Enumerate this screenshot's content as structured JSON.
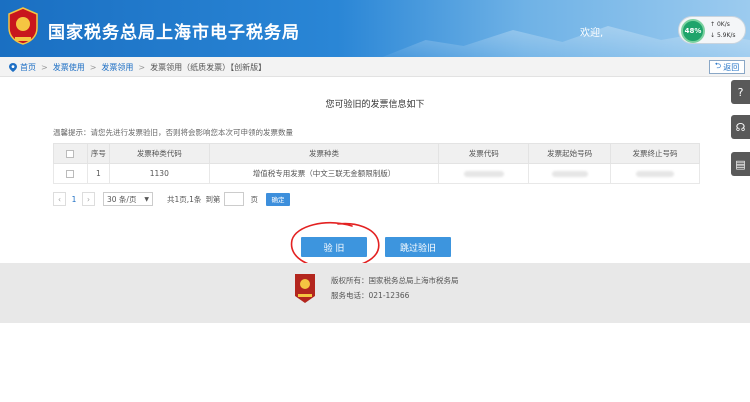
{
  "header": {
    "site_title": "国家税务总局上海市电子税务局",
    "welcome": "欢迎,",
    "gauge_percent": "48%",
    "gauge_up": "0K/s",
    "gauge_down": "5.9K/s"
  },
  "breadcrumb": {
    "items": [
      "首页",
      "发票使用",
      "发票领用",
      "发票领用（纸质发票）【创新版】"
    ]
  },
  "back_label": "返回",
  "side_tools": [
    "?",
    "☊",
    "▤"
  ],
  "heading": "您可验旧的发票信息如下",
  "tip": "温馨提示：请您先进行发票验旧，否则将会影响您本次可申领的发票数量",
  "table": {
    "headers": [
      "",
      "序号",
      "发票种类代码",
      "发票种类",
      "发票代码",
      "发票起始号码",
      "发票终止号码"
    ],
    "rows": [
      {
        "index": "1",
        "type_code": "1130",
        "type_name": "增值税专用发票（中文三联无金额限制版）"
      }
    ]
  },
  "pager": {
    "prev": "‹",
    "page": "1",
    "next": "›",
    "page_size": "30 条/页",
    "total": "共1页,1条",
    "goto": "到第",
    "page_unit": "页",
    "confirm": "确定"
  },
  "buttons": {
    "verify": "验 旧",
    "skip": "跳过验旧"
  },
  "footer": {
    "copyright": "版权所有：国家税务总局上海市税务局",
    "phone": "服务电话：021-12366",
    "logo_text": "税务服务"
  },
  "colors": {
    "header_blue": "#1a6fc2",
    "button_blue": "#3d95de",
    "annotation_red": "#e32222"
  }
}
